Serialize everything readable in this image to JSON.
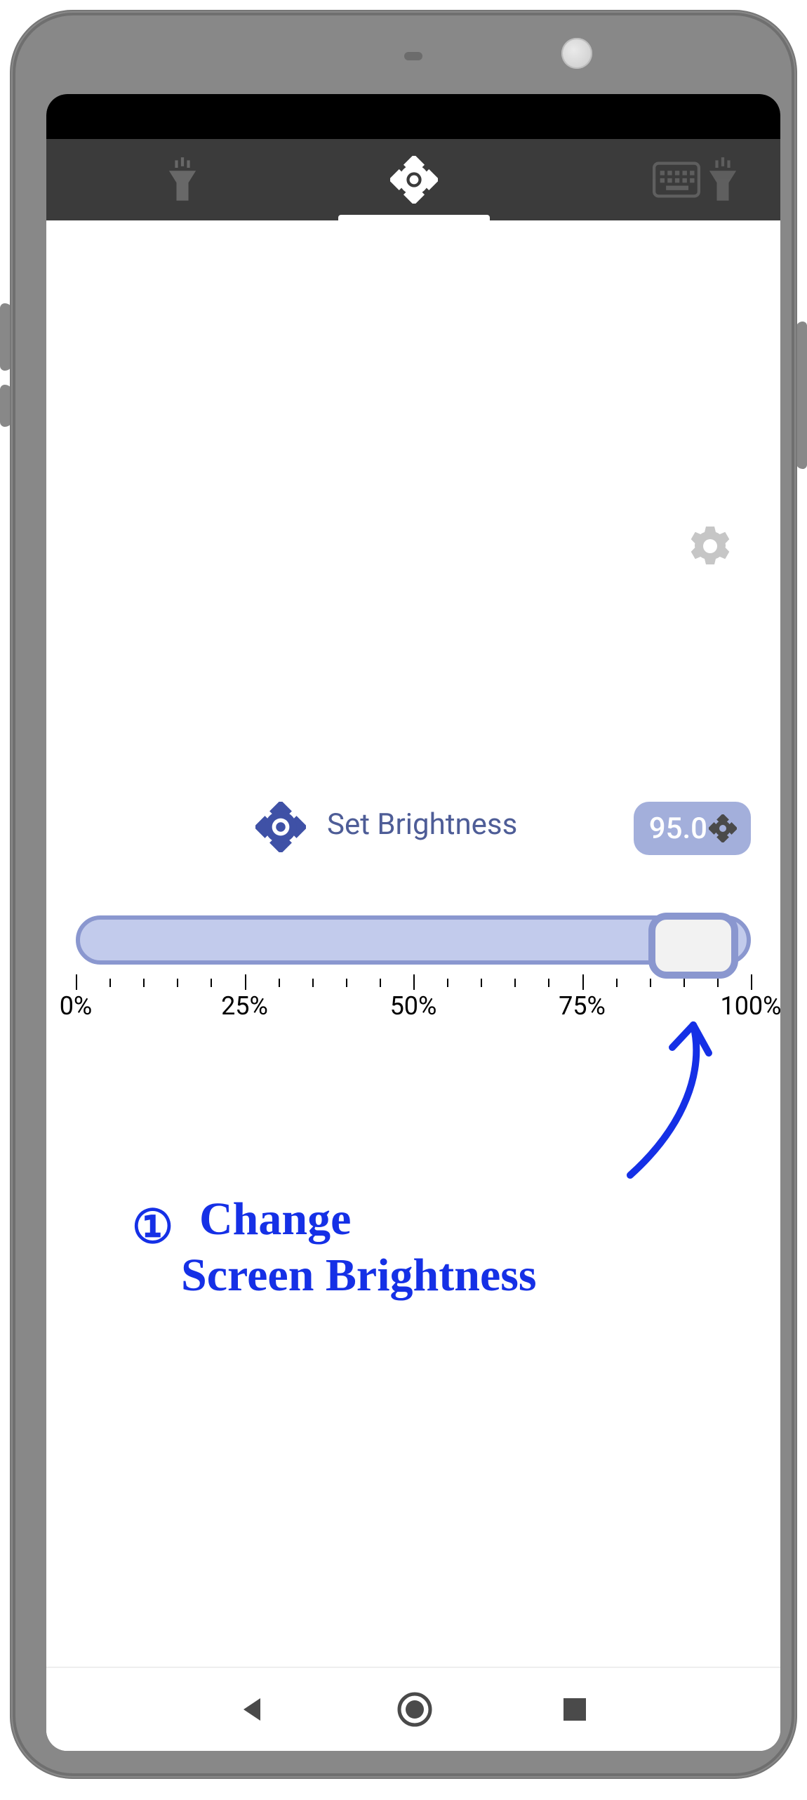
{
  "tabs": {
    "left_icon": "torch-icon",
    "center_icon": "brightness-icon",
    "right_kbd_icon": "keyboard-icon",
    "right_torch_icon": "torch-icon"
  },
  "settings_icon": "gear-icon",
  "brightness": {
    "label": "Set Brightness",
    "value": "95.0",
    "min": 0,
    "max": 100
  },
  "slider_ticks": {
    "labels": [
      "0%",
      "25%",
      "50%",
      "75%",
      "100%"
    ]
  },
  "annotation": {
    "step": "①",
    "text_line1": "Change",
    "text_line2": "Screen Brightness"
  },
  "nav": {
    "back": "back-triangle",
    "home": "home-circle",
    "recent": "recent-square"
  }
}
